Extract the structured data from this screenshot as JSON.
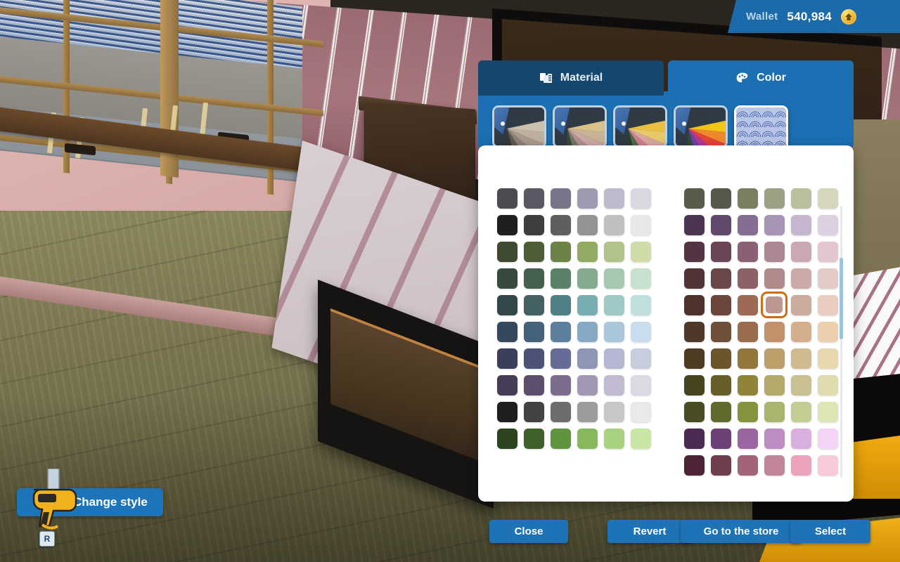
{
  "hud": {
    "wallet_label": "Wallet",
    "wallet_amount": "540,984",
    "coin_icon": "coin-icon",
    "change_style_label": "Change style",
    "change_style_key": "R",
    "tool_icon": "drill-icon"
  },
  "picker": {
    "tabs": [
      {
        "label": "Material",
        "icon": "material-icon",
        "active": false
      },
      {
        "label": "Color",
        "icon": "palette-icon",
        "active": true
      }
    ],
    "thumbnails": [
      {
        "name": "palette-neutral-fan",
        "type": "fan",
        "selected": false,
        "colors": [
          "#cbbfae",
          "#bdb0a0",
          "#a89a8b",
          "#8c8376",
          "#5f5a52",
          "#3a3733"
        ]
      },
      {
        "name": "palette-warm-fan",
        "type": "fan",
        "selected": false,
        "colors": [
          "#d7c08a",
          "#c8b394",
          "#caa9a4",
          "#b58f93",
          "#6f7a62",
          "#394a3d"
        ]
      },
      {
        "name": "palette-bright-fan",
        "type": "fan",
        "selected": false,
        "colors": [
          "#e8bf3e",
          "#e7c96a",
          "#dba6a0",
          "#d07f8f",
          "#4f6a4a",
          "#2b3d33"
        ]
      },
      {
        "name": "palette-vivid-fan",
        "type": "fan",
        "selected": false,
        "colors": [
          "#f3c517",
          "#f0892c",
          "#e2453a",
          "#b5379a",
          "#6d3fa6",
          "#2f4d38"
        ]
      },
      {
        "name": "pattern-seigaiha",
        "type": "pattern",
        "selected": true,
        "colors": [
          "#b9c6e8",
          "#4c67ad"
        ]
      }
    ],
    "scroll": {
      "name": "color-scrollbar",
      "thumb_top_pct": 19,
      "thumb_height_pct": 30
    },
    "selected_swatch": {
      "grid": "right",
      "row": 5,
      "col": 4,
      "color": "#bc9691",
      "ring_color": "#cc6d14"
    }
  },
  "buttons": [
    {
      "id": "close",
      "label": "Close"
    },
    {
      "id": "revert",
      "label": "Revert"
    },
    {
      "id": "store",
      "label": "Go to the store"
    },
    {
      "id": "select",
      "label": "Select"
    }
  ],
  "swatches": {
    "left": [
      [
        "#4b4b51",
        "#5b5765",
        "#787489",
        "#9e9bb0",
        "#bdbbcb",
        "#d8d7e2"
      ],
      [
        "#1f1f1f",
        "#3e3e3e",
        "#5f5f5f",
        "#939393",
        "#c0c0c0",
        "#e8e8e8"
      ],
      [
        "#3f4a33",
        "#4d5d37",
        "#6d8246",
        "#92ab63",
        "#b0c389",
        "#cfdca8"
      ],
      [
        "#374a3f",
        "#46604f",
        "#5d8068",
        "#85ab8f",
        "#a6c8ae",
        "#c6e2cc"
      ],
      [
        "#34474a",
        "#446065",
        "#4f8086",
        "#78aeaf",
        "#9dc9c7",
        "#c0e0dd"
      ],
      [
        "#36495c",
        "#45617b",
        "#5c7f9d",
        "#86aac4",
        "#aac6da",
        "#c9dded"
      ],
      [
        "#3c3f5c",
        "#4d5377",
        "#656c97",
        "#8e95b7",
        "#b2b8d1",
        "#c8cddd"
      ],
      [
        "#453d55",
        "#5b4f6c",
        "#7c6d8c",
        "#a398b3",
        "#c2bad0",
        "#dcd8e6"
      ],
      [
        "#1e1e1e",
        "#434343",
        "#6d6d6d",
        "#9c9c9c",
        "#c7c7c7",
        "#e9e9e9"
      ],
      [
        "#2d4421",
        "#3f6129",
        "#609440",
        "#86b95b",
        "#a9d27f",
        "#c8e6a4"
      ]
    ],
    "right": [
      [
        "#5a5c4b",
        "#56584a",
        "#7b7f62",
        "#9ba183",
        "#bcbf9e",
        "#d5d6bb"
      ],
      [
        "#4b3552",
        "#61496c",
        "#856e92",
        "#a895b6",
        "#c6b6cf",
        "#ded0e3"
      ],
      [
        "#543444",
        "#6a4557",
        "#8b6074",
        "#ad8894",
        "#c9a8b1",
        "#e1c7cd"
      ],
      [
        "#513436",
        "#6b4749",
        "#8d6266",
        "#b08a8b",
        "#cbaaa9",
        "#e3cbc7"
      ],
      [
        "#4d332c",
        "#6b463d",
        "#9d6a56",
        "#bc9691",
        "#ccaa9e",
        "#e9cdc0"
      ],
      [
        "#4e382a",
        "#70503a",
        "#996c4c",
        "#c2906a",
        "#d4ae8d",
        "#edcfae"
      ],
      [
        "#4c3d22",
        "#6b562c",
        "#93773a",
        "#bda069",
        "#cfbb8f",
        "#e7d9ad"
      ],
      [
        "#48431f",
        "#675f2a",
        "#8f8438",
        "#b3a96a",
        "#c8c091",
        "#e0dcae"
      ],
      [
        "#4a4d24",
        "#5f6a2c",
        "#85933c",
        "#a8b56c",
        "#c3cd93",
        "#dde6b2"
      ],
      [
        "#4a2952",
        "#6d4077",
        "#9a65a0",
        "#bd8cc3",
        "#dbafdd",
        "#f3d4f5"
      ],
      [
        "#4d2337",
        "#6f3d50",
        "#a1647a",
        "#c2869c",
        "#eda2bb",
        "#f7cada"
      ]
    ]
  }
}
